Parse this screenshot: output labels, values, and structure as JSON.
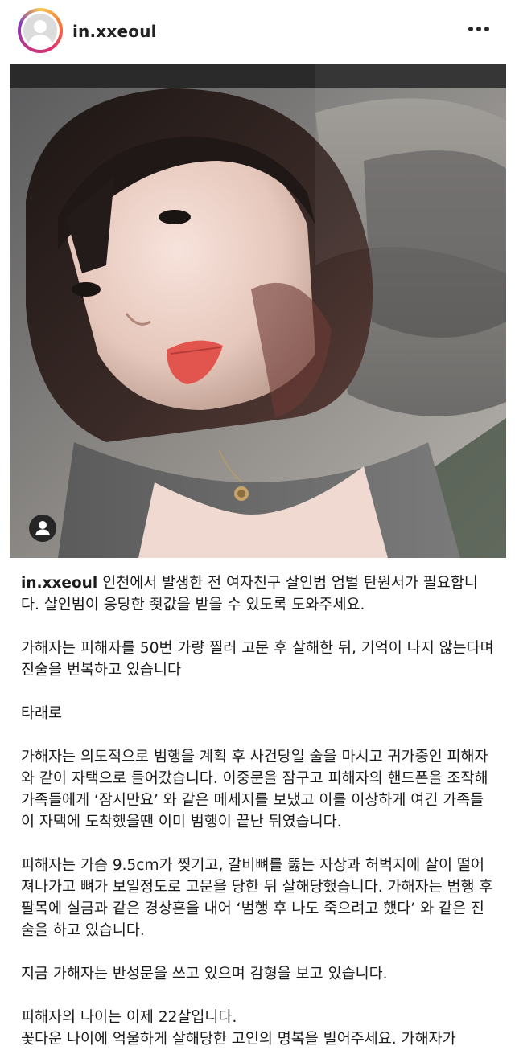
{
  "post": {
    "username": "in.xxeoul",
    "more_icon": "more-horizontal-icon",
    "user_tag_icon": "person-icon"
  },
  "caption": {
    "username": "in.xxeoul",
    "first_text": "인천에서 발생한 전 여자친구 살인범 엄벌 탄원서가 필요합니다. 살인범이 응당한 죗값을 받을 수 있도록 도와주세요.",
    "para1": "가해자는 피해자를 50번 가량 찔러 고문 후 살해한 뒤, 기억이 나지 않는다며 진술을 번복하고 있습니다",
    "para2": "타래로",
    "para3": "가해자는 의도적으로 범행을 계획 후 사건당일 술을 마시고 귀가중인 피해자와 같이 자택으로 들어갔습니다. 이중문을 잠구고 피해자의 핸드폰을 조작해 가족들에게 ‘잠시만요’ 와 같은 메세지를 보냈고 이를 이상하게 여긴 가족들이 자택에 도착했을땐 이미 범행이 끝난 뒤였습니다.",
    "para4": "피해자는 가슴 9.5cm가 찢기고, 갈비뼈를 뚫는 자상과 허벅지에 살이 떨어져나가고 뼈가 보일정도로 고문을 당한 뒤 살해당했습니다. 가해자는 범행 후 팔목에 실금과 같은 경상흔을 내어 ‘범행 후 나도 죽으려고 했다’ 와 같은 진술을 하고 있습니다.",
    "para5": "지금 가해자는 반성문을 쓰고 있으며 감형을 보고 있습니다.",
    "para6": "피해자의 나이는 이제 22살입니다.",
    "para7": "꽃다운 나이에 억울하게 살해당한 고인의 명복을 빌어주세요. 가해자가"
  },
  "colors": {
    "ring_gradient": [
      "#f9c74f",
      "#f77737",
      "#e1306c",
      "#c13584",
      "#833ab4"
    ],
    "text": "#1b1b1b"
  }
}
